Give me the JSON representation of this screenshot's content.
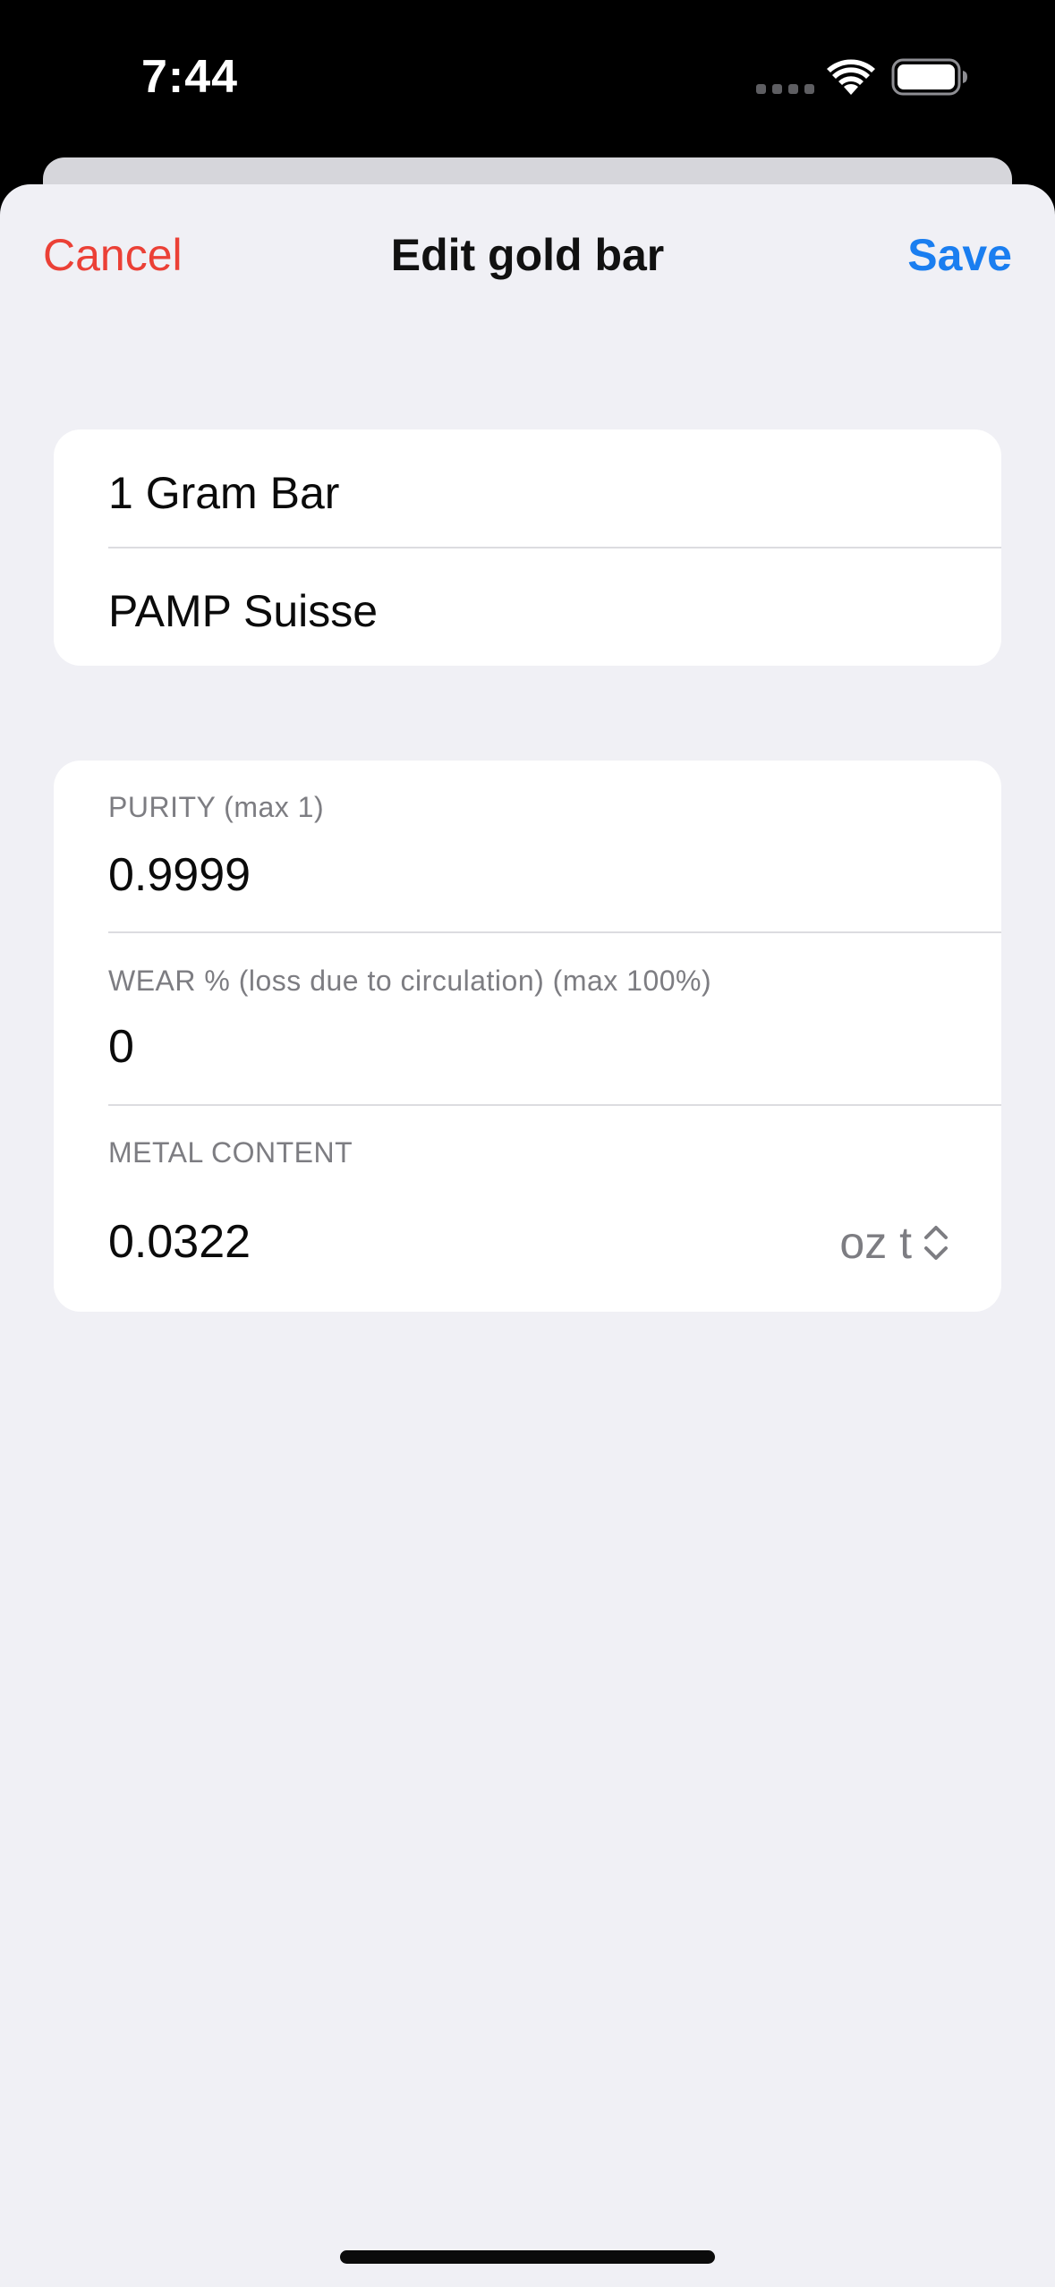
{
  "status_bar": {
    "time": "7:44",
    "icons": [
      "signal-dots-icon",
      "wifi-icon",
      "battery-icon"
    ]
  },
  "nav": {
    "cancel_label": "Cancel",
    "title": "Edit gold bar",
    "save_label": "Save"
  },
  "details": {
    "name": "1 Gram Bar",
    "manufacturer": "PAMP Suisse"
  },
  "fields": {
    "purity": {
      "label": "PURITY (max 1)",
      "value": "0.9999"
    },
    "wear": {
      "label": "WEAR % (loss due to circulation) (max 100%)",
      "value": "0"
    },
    "metal_content": {
      "label": "METAL CONTENT",
      "value": "0.0322",
      "unit": "oz t"
    }
  },
  "colors": {
    "cancel": "#eb4036",
    "save": "#1a7ef0",
    "sheet_background": "#f0f0f5",
    "card_background": "#ffffff"
  }
}
